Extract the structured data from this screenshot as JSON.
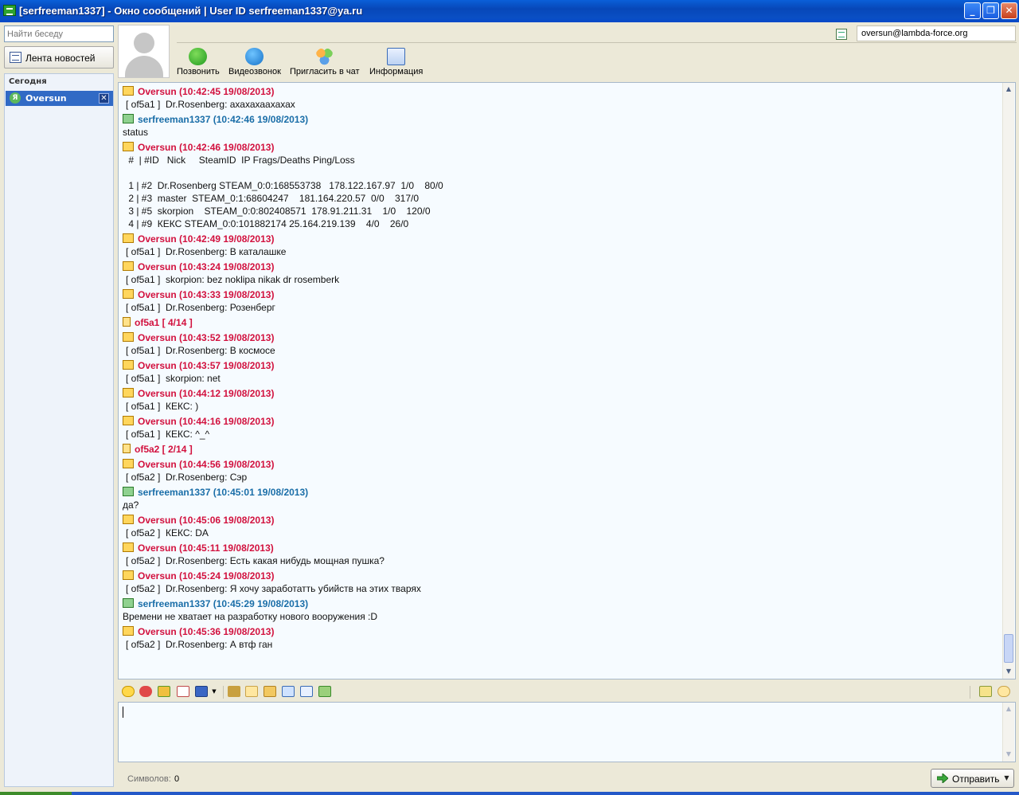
{
  "window": {
    "title": "[serfreeman1337] - Окно сообщений  |  User ID serfreeman1337@ya.ru",
    "minimize": "_",
    "maximize": "❐",
    "close": "✕"
  },
  "sidebar": {
    "search_placeholder": "Найти беседу",
    "news_button": "Лента новостей",
    "group_label": "Сегодня",
    "contact": {
      "badge": "Я",
      "name": "Oversun",
      "close": "✕"
    }
  },
  "toolbar": {
    "call": "Позвонить",
    "video": "Видеозвонок",
    "invite": "Пригласить в чат",
    "info": "Информация",
    "account": "oversun@lambda-force.org"
  },
  "messages": [
    {
      "kind": "in",
      "header": "Oversun (10:42:45 19/08/2013)",
      "lines": [
        "[ of5a1 ]  Dr.Rosenberg: ахахахаахахах"
      ]
    },
    {
      "kind": "out",
      "header": "serfreeman1337 (10:42:46 19/08/2013)",
      "lines": [
        "status"
      ]
    },
    {
      "kind": "in",
      "header": "Oversun (10:42:46 19/08/2013)",
      "lines": [
        " #  | #ID   Nick     SteamID  IP Frags/Deaths Ping/Loss",
        "",
        " 1 | #2  Dr.Rosenberg STEAM_0:0:168553738   178.122.167.97  1/0    80/0",
        " 2 | #3  master  STEAM_0:1:68604247    181.164.220.57  0/0    317/0",
        " 3 | #5  skorpion    STEAM_0:0:802408571  178.91.211.31    1/0    120/0",
        " 4 | #9  КЕКС STEAM_0:0:101882174 25.164.219.139    4/0    26/0"
      ]
    },
    {
      "kind": "in",
      "header": "Oversun (10:42:49 19/08/2013)",
      "lines": [
        "[ of5a1 ]  Dr.Rosenberg: В каталашке"
      ]
    },
    {
      "kind": "in",
      "header": "Oversun (10:43:24 19/08/2013)",
      "lines": [
        "[ of5a1 ]  skorpion: bez noklipa nikak dr rosemberk"
      ]
    },
    {
      "kind": "in",
      "header": "Oversun (10:43:33 19/08/2013)",
      "lines": [
        "[ of5a1 ]  Dr.Rosenberg: Розенберг"
      ]
    },
    {
      "kind": "note",
      "header": "of5a1 [ 4/14 ]",
      "lines": []
    },
    {
      "kind": "in",
      "header": "Oversun (10:43:52 19/08/2013)",
      "lines": [
        "[ of5a1 ]  Dr.Rosenberg: В космосе"
      ]
    },
    {
      "kind": "in",
      "header": "Oversun (10:43:57 19/08/2013)",
      "lines": [
        "[ of5a1 ]  skorpion: net"
      ]
    },
    {
      "kind": "in",
      "header": "Oversun (10:44:12 19/08/2013)",
      "lines": [
        "[ of5a1 ]  КЕКС: )"
      ]
    },
    {
      "kind": "in",
      "header": "Oversun (10:44:16 19/08/2013)",
      "lines": [
        "[ of5a1 ]  КЕКС: ^_^"
      ]
    },
    {
      "kind": "note",
      "header": "of5a2 [ 2/14 ]",
      "lines": []
    },
    {
      "kind": "in",
      "header": "Oversun (10:44:56 19/08/2013)",
      "lines": [
        "[ of5a2 ]  Dr.Rosenberg: Сэр"
      ]
    },
    {
      "kind": "out",
      "header": "serfreeman1337 (10:45:01 19/08/2013)",
      "lines": [
        "да?"
      ]
    },
    {
      "kind": "in",
      "header": "Oversun (10:45:06 19/08/2013)",
      "lines": [
        "[ of5a2 ]  КЕКС: DA"
      ]
    },
    {
      "kind": "in",
      "header": "Oversun (10:45:11 19/08/2013)",
      "lines": [
        "[ of5a2 ]  Dr.Rosenberg: Есть какая нибудь мощная пушка?"
      ]
    },
    {
      "kind": "in",
      "header": "Oversun (10:45:24 19/08/2013)",
      "lines": [
        "[ of5a2 ]  Dr.Rosenberg: Я хочу заработатть убийств на этих тварях"
      ]
    },
    {
      "kind": "out",
      "header": "serfreeman1337 (10:45:29 19/08/2013)",
      "lines": [
        "Времени не хватает на разработку нового вооружения :D"
      ]
    },
    {
      "kind": "in",
      "header": "Oversun (10:45:36 19/08/2013)",
      "lines": [
        "[ of5a2 ]  Dr.Rosenberg: А втф ган"
      ]
    }
  ],
  "compose": {
    "char_label": "Символов:",
    "char_count": "0",
    "send": "Отправить",
    "send_dropdown": "▼",
    "icons": [
      "smiley-icon",
      "sticker-icon",
      "forward-icon",
      "calendar-icon",
      "save-icon",
      "save-dropdown-icon",
      "tools-icon",
      "folder-open-icon",
      "folder-share-icon",
      "image-send-icon",
      "compress-icon",
      "file-transfer-icon"
    ]
  },
  "colors": {
    "incoming": "#d2113e",
    "outgoing": "#1a6ea8",
    "titlebar": "#0a4fc4",
    "selection": "#316ac5"
  }
}
